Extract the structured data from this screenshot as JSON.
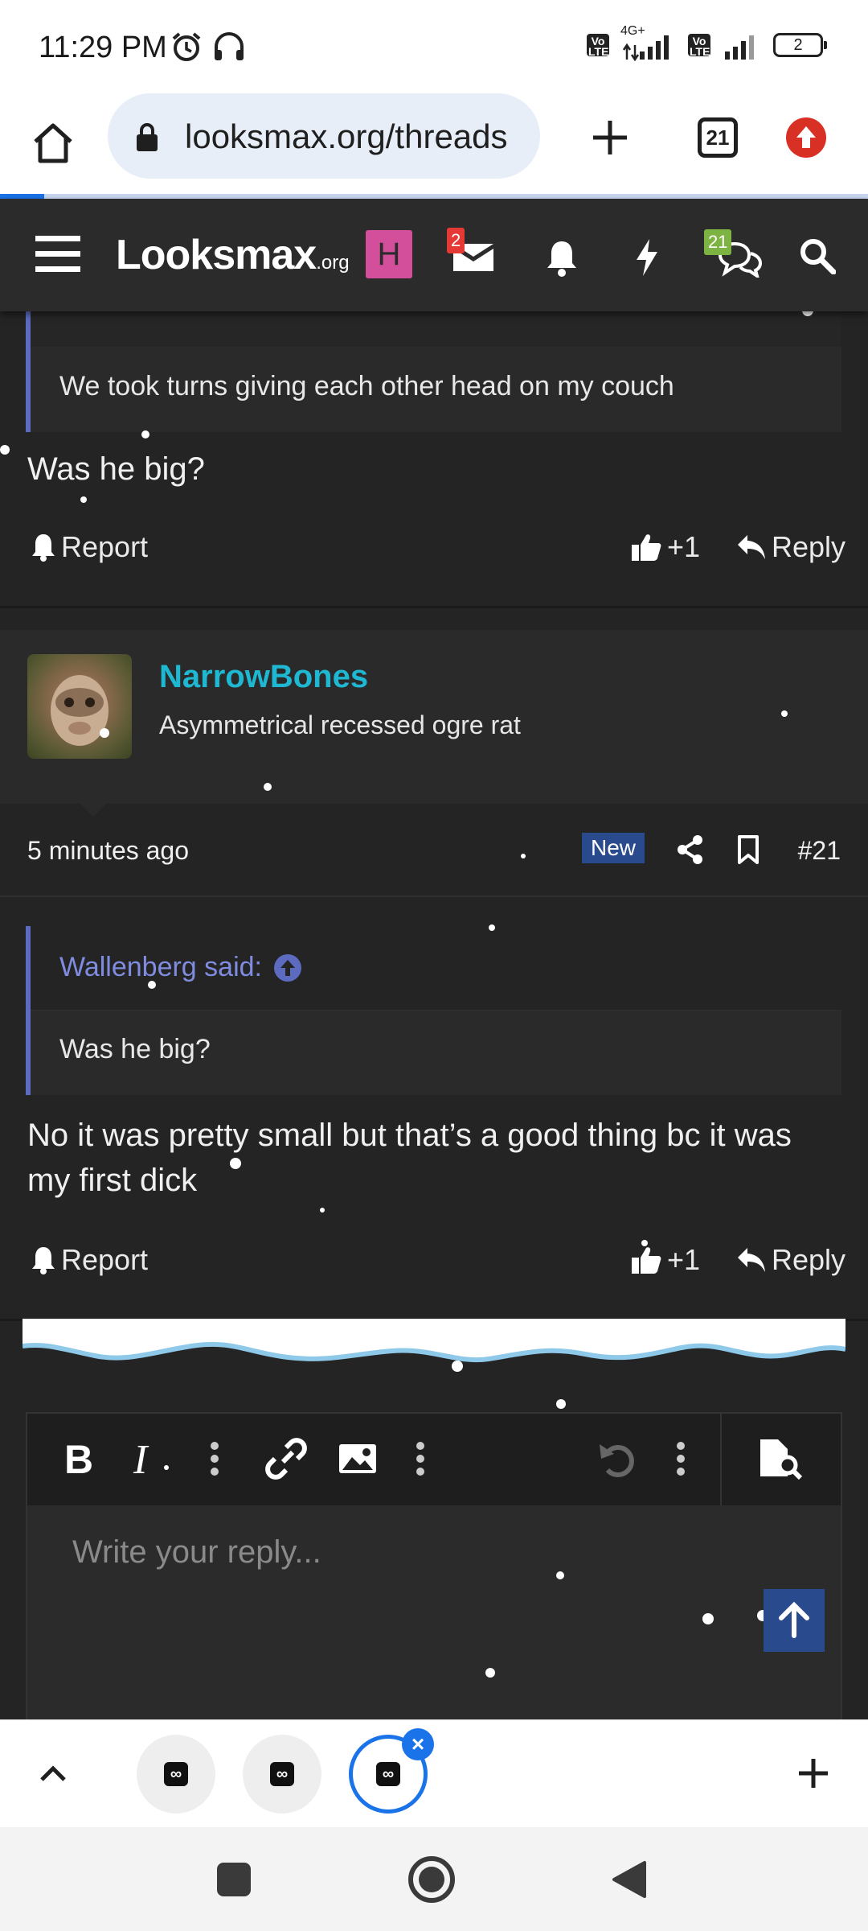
{
  "status_bar": {
    "time": "11:29 PM",
    "network": "4G+",
    "volte1": "Vo LTE",
    "volte2": "Vo LTE",
    "battery": "2"
  },
  "browser": {
    "url": "looksmax.org/threads",
    "tab_count": "21"
  },
  "forum_header": {
    "logo_main": "Looksmax",
    "logo_suffix": ".org",
    "user_avatar_letter": "H",
    "inbox_count": "2",
    "alerts_count": "21"
  },
  "previous_post": {
    "quote_text": "We took turns giving each other head on my couch",
    "body": "Was he big?",
    "report_label": "Report",
    "like_label": "+1",
    "reply_label": "Reply"
  },
  "post": {
    "username": "NarrowBones",
    "user_title": "Asymmetrical recessed ogre rat",
    "time": "5 minutes ago",
    "badge": "New",
    "number": "#21",
    "quote_author": "Wallenberg said:",
    "quote_text": "Was he big?",
    "body": "No it was pretty small but that’s a good thing bc it was my first dick",
    "report_label": "Report",
    "like_label": "+1",
    "reply_label": "Reply"
  },
  "editor": {
    "placeholder": "Write your reply..."
  },
  "colors": {
    "accent_blue": "#2a4a8e",
    "username_cyan": "#1fb8d3",
    "quote_bar": "#5c6bc0",
    "page_bg": "#242424"
  }
}
